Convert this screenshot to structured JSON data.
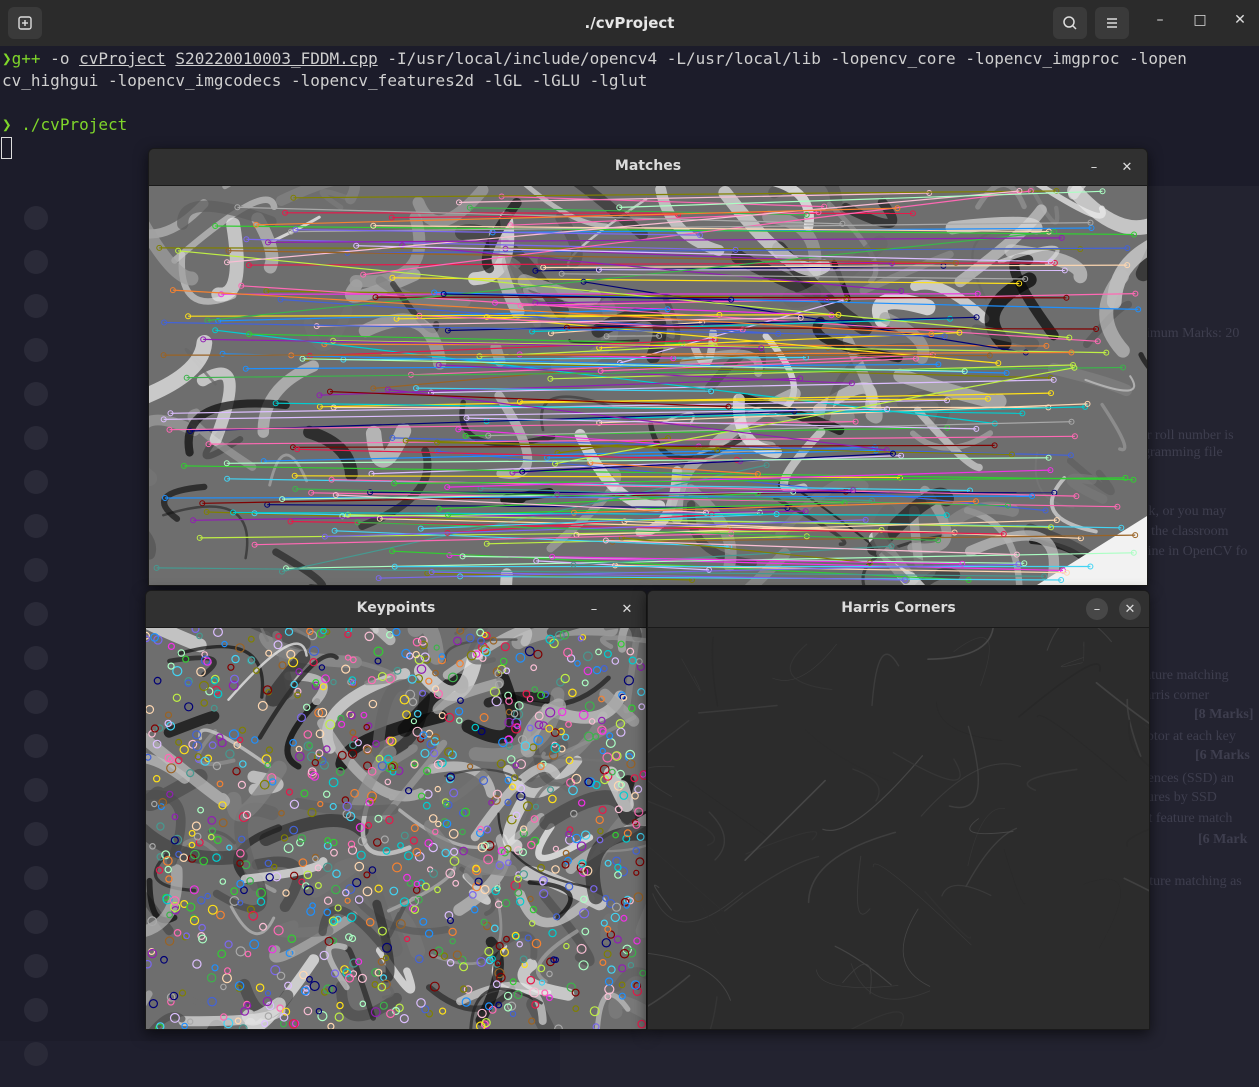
{
  "terminal": {
    "title": "./cvProject",
    "new_tab_icon": "new-tab-icon",
    "search_icon": "search-icon",
    "menu_icon": "hamburger-menu-icon",
    "minimize": "–",
    "maximize": "□",
    "close": "✕",
    "lines": [
      {
        "prompt": "❯",
        "cmd": "g++",
        "p1": " -o ",
        "u1": "cvProject",
        "sp": " ",
        "u2": "S20220010003_FDDM.cpp",
        "rest": " -I/usr/local/include/opencv4 -L/usr/local/lib -lopencv_core -lopencv_imgproc -lopen"
      },
      {
        "text": "cv_highgui -lopencv_imgcodecs -lopencv_features2d -lGL -lGLU -lglut"
      },
      {
        "prompt": "❯",
        "cmd": "./cvProject"
      }
    ]
  },
  "background_doc": {
    "fragments": [
      "imum Marks: 20",
      "ir roll number is",
      "gramming file",
      "sk, or you may",
      "r the classroom",
      "fine in OpenCV fo",
      "ature matching",
      "arris corner",
      "[8 Marks]",
      "iptor at each key",
      "[6 Marks",
      "rences (SSD) an",
      "tures by SSD",
      "st feature match",
      "[6 Mark",
      "ature matching as"
    ]
  },
  "windows": {
    "matches": {
      "title": "Matches",
      "min": "–",
      "close": "✕"
    },
    "keypoints": {
      "title": "Keypoints",
      "min": "–",
      "close": "✕"
    },
    "harris": {
      "title": "Harris Corners",
      "min": "–",
      "close": "✕"
    }
  }
}
